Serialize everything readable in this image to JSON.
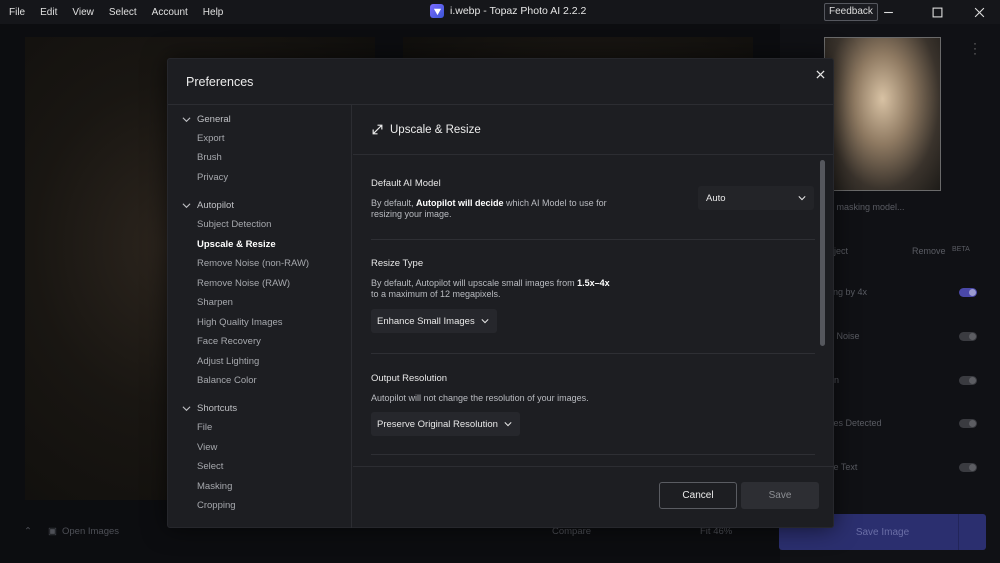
{
  "menu": [
    "File",
    "Edit",
    "View",
    "Select",
    "Account",
    "Help"
  ],
  "window": {
    "title": "i.webp - Topaz Photo AI 2.2.2",
    "feedback_label": "Feedback"
  },
  "background": {
    "side_items": [
      "g masking model...",
      "bject",
      "Remove",
      "BETA",
      "ling by 4x",
      "e Noise",
      "en",
      "ces Detected",
      "ve Text"
    ],
    "open_images_label": "Open Images",
    "compare_label": "Compare",
    "zoom_label": "Fit 46%",
    "save_image_label": "Save Image"
  },
  "preferences": {
    "title": "Preferences",
    "nav": {
      "general": {
        "label": "General",
        "items": [
          "Export",
          "Brush",
          "Privacy"
        ]
      },
      "autopilot": {
        "label": "Autopilot",
        "items": [
          "Subject Detection",
          "Upscale & Resize",
          "Remove Noise (non-RAW)",
          "Remove Noise (RAW)",
          "Sharpen",
          "High Quality Images",
          "Face Recovery",
          "Adjust Lighting",
          "Balance Color"
        ],
        "active": "Upscale & Resize"
      },
      "shortcuts": {
        "label": "Shortcuts",
        "items": [
          "File",
          "View",
          "Select",
          "Masking",
          "Cropping"
        ]
      }
    },
    "section_title": "Upscale & Resize",
    "default_model": {
      "title": "Default AI Model",
      "desc_pre": "By default, ",
      "desc_bold": "Autopilot will decide",
      "desc_post": " which AI Model to use for resizing your image.",
      "value": "Auto"
    },
    "resize_type": {
      "title": "Resize Type",
      "desc_pre": "By default, Autopilot will upscale small images from ",
      "desc_bold": "1.5x–4x",
      "desc_post": " to a maximum of 12 megapixels.",
      "value": "Enhance Small Images"
    },
    "output_resolution": {
      "title": "Output Resolution",
      "desc": "Autopilot will not change the resolution of your images.",
      "value": "Preserve Original Resolution"
    },
    "cancel_label": "Cancel",
    "save_label": "Save"
  }
}
